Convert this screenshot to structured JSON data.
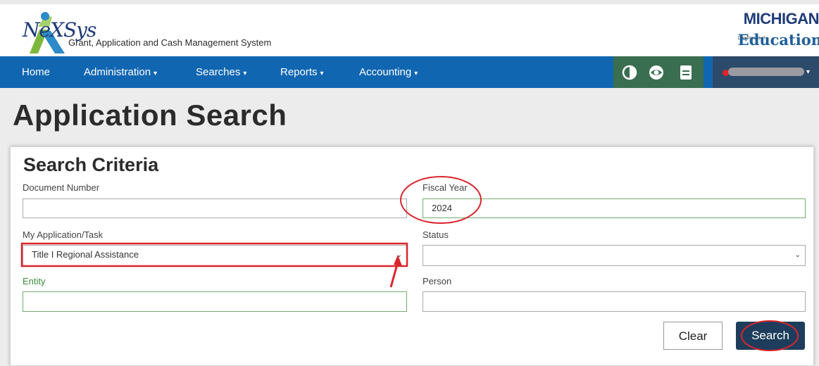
{
  "header": {
    "logo_text": "NeXSys",
    "subtitle": "Grant, Application and Cash Management System",
    "state_logo_top": "MICHIGAN",
    "state_logo_dept": "Department of",
    "state_logo_bottom": "Education"
  },
  "nav": {
    "items": [
      {
        "label": "Home",
        "has_dropdown": false
      },
      {
        "label": "Administration",
        "has_dropdown": true
      },
      {
        "label": "Searches",
        "has_dropdown": true
      },
      {
        "label": "Reports",
        "has_dropdown": true
      },
      {
        "label": "Accounting",
        "has_dropdown": true
      }
    ],
    "dropdown_caret": "▾",
    "tools": [
      "contrast-icon",
      "eye-icon",
      "document-icon"
    ],
    "user_caret": "▾"
  },
  "page": {
    "title": "Application Search"
  },
  "search_criteria": {
    "title": "Search Criteria",
    "document_number": {
      "label": "Document Number",
      "value": ""
    },
    "fiscal_year": {
      "label": "Fiscal Year",
      "value": "2024"
    },
    "my_application_task": {
      "label": "My Application/Task",
      "value": "Title I Regional Assistance"
    },
    "status": {
      "label": "Status",
      "value": ""
    },
    "entity": {
      "label": "Entity",
      "value": ""
    },
    "person": {
      "label": "Person",
      "value": ""
    },
    "clear_label": "Clear",
    "search_label": "Search"
  },
  "colors": {
    "nav_bg": "#1166b1",
    "tools_bg": "#3a6e50",
    "user_bg": "#2c4a6a",
    "search_button": "#1e3d5c",
    "annotation_red": "#d9262c"
  }
}
